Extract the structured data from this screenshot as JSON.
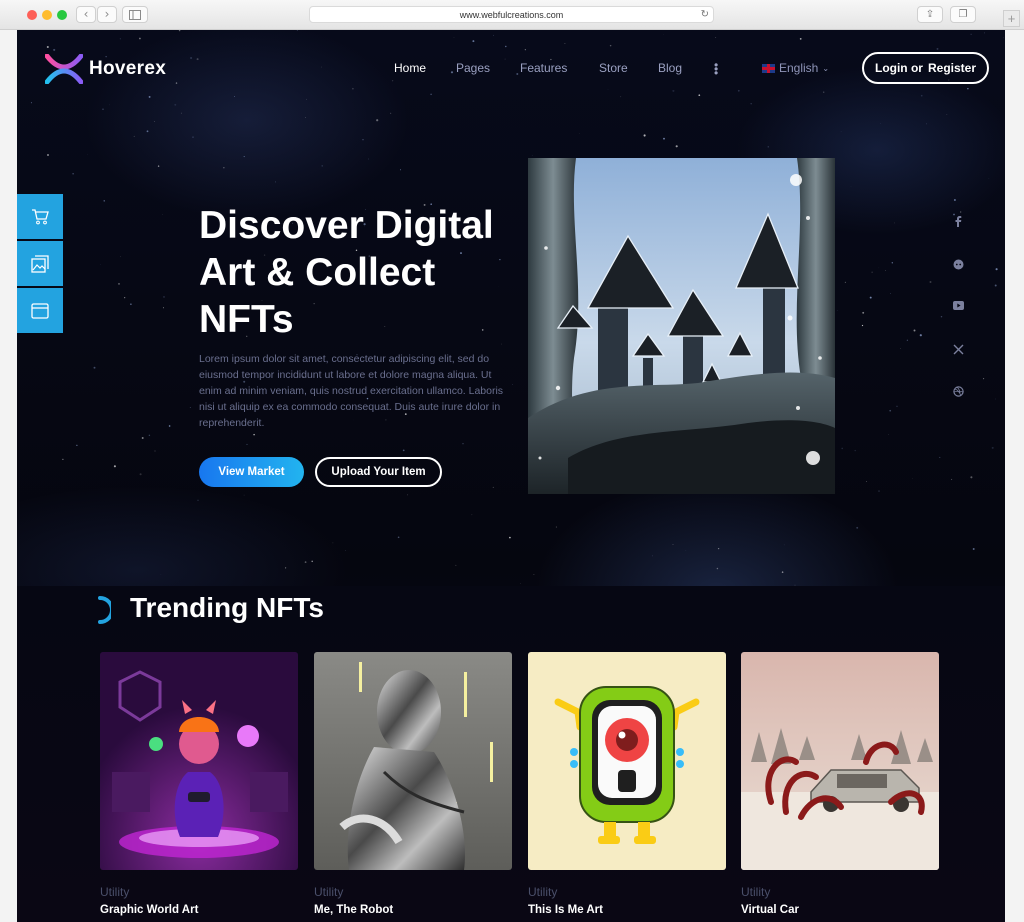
{
  "browser": {
    "url": "www.webfulcreations.com"
  },
  "header": {
    "logo_text": "Hoverex",
    "nav": [
      {
        "label": "Home",
        "active": true
      },
      {
        "label": "Pages",
        "active": false
      },
      {
        "label": "Features",
        "active": false
      },
      {
        "label": "Store",
        "active": false
      },
      {
        "label": "Blog",
        "active": false
      }
    ],
    "language": "English",
    "login_label": "Login or",
    "register_label": "Register"
  },
  "sidebar": {
    "icons": [
      "cart-icon",
      "image-gallery-icon",
      "browser-window-icon"
    ]
  },
  "social": {
    "icons": [
      "facebook-icon",
      "reddit-icon",
      "youtube-icon",
      "x-twitter-icon",
      "dribbble-icon"
    ]
  },
  "hero": {
    "title": "Discover Digital Art & Collect NFTs",
    "description": "Lorem ipsum dolor sit amet, consectetur adipiscing elit, sed do eiusmod tempor incididunt ut labore et dolore magna aliqua. Ut enim ad minim veniam, quis nostrud exercitation ullamco. Laboris nisi ut aliquip ex ea commodo consequat. Duis aute irure dolor in reprehenderit.",
    "primary_button": "View Market",
    "secondary_button": "Upload Your Item"
  },
  "trending": {
    "title": "Trending NFTs",
    "cards": [
      {
        "category": "Utility",
        "title": "Graphic World Art"
      },
      {
        "category": "Utility",
        "title": "Me, The Robot"
      },
      {
        "category": "Utility",
        "title": "This Is Me Art"
      },
      {
        "category": "Utility",
        "title": "Virtual Car"
      }
    ]
  },
  "colors": {
    "accent": "#23a3e0",
    "background": "#060713",
    "button_gradient_start": "#1877ef",
    "button_gradient_end": "#22b4ef"
  }
}
